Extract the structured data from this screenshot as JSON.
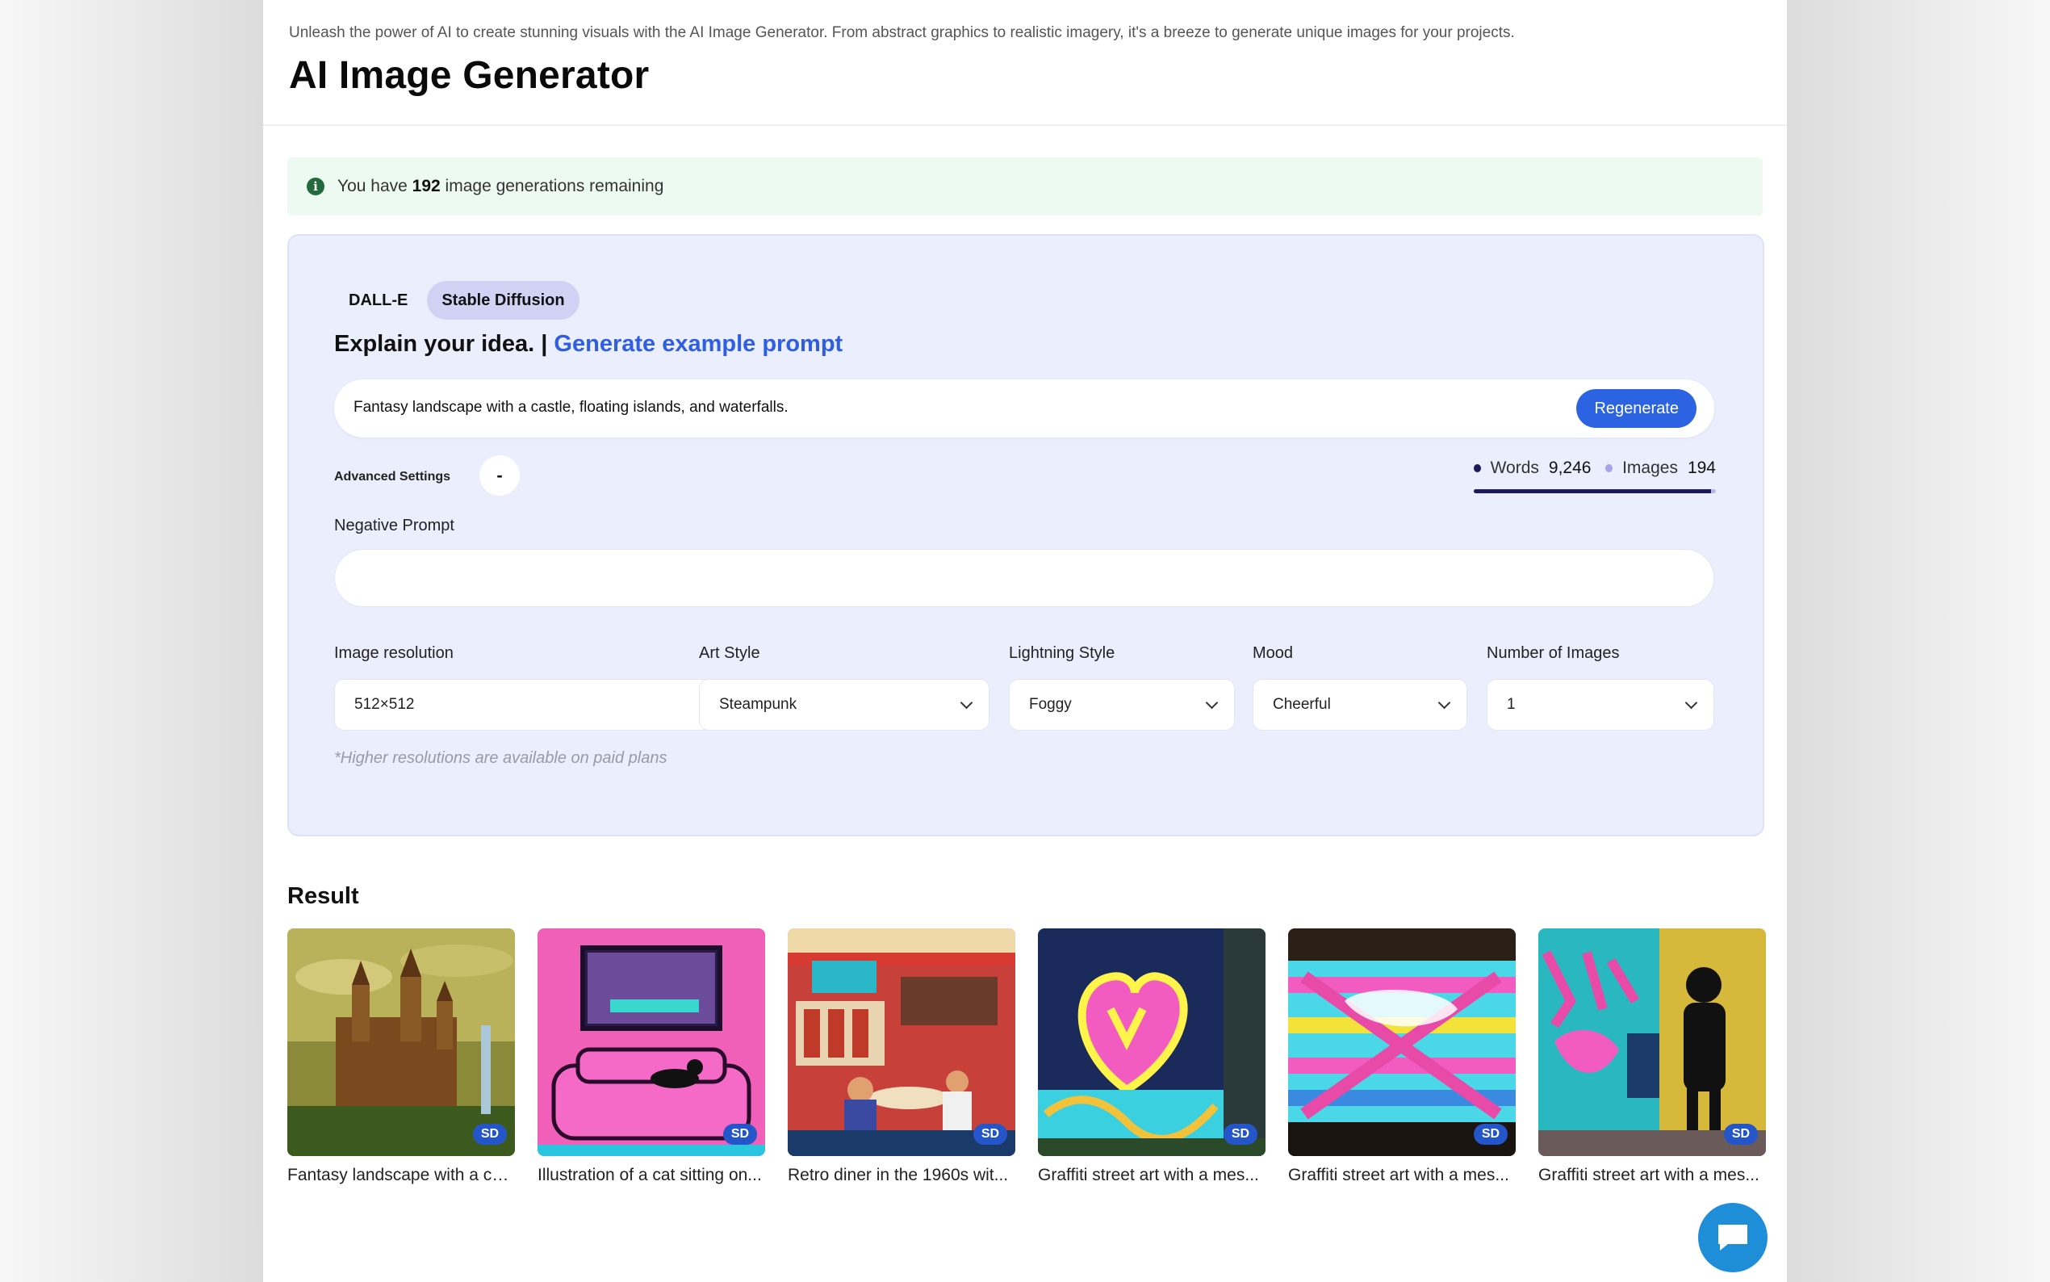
{
  "header": {
    "subtitle": "Unleash the power of AI to create stunning visuals with the AI Image Generator. From abstract graphics to realistic imagery, it's a breeze to generate unique images for your projects.",
    "title": "AI Image Generator"
  },
  "alert": {
    "prefix": "You have",
    "count": "192",
    "suffix": "image generations remaining",
    "icon": "info-icon",
    "color": "#236b3c"
  },
  "engines": [
    {
      "label": "DALL-E",
      "active": false
    },
    {
      "label": "Stable Diffusion",
      "active": true
    }
  ],
  "idea": {
    "heading": "Explain your idea. |",
    "link": "Generate example prompt"
  },
  "prompt": {
    "value": "Fantasy landscape with a castle, floating islands, and waterfalls.",
    "button": "Regenerate"
  },
  "advanced": {
    "label": "Advanced Settings",
    "toggle": "-"
  },
  "credits": {
    "words_label": "Words",
    "words_value": "9,246",
    "images_label": "Images",
    "images_value": "194",
    "words_fraction": 0.98
  },
  "negative_prompt": {
    "label": "Negative Prompt",
    "value": ""
  },
  "settings": {
    "resolution": {
      "label": "Image resolution",
      "value": "512×512"
    },
    "art_style": {
      "label": "Art Style",
      "value": "Steampunk"
    },
    "lighting": {
      "label": "Lightning Style",
      "value": "Foggy"
    },
    "mood": {
      "label": "Mood",
      "value": "Cheerful"
    },
    "count": {
      "label": "Number of Images",
      "value": "1"
    }
  },
  "note": "*Higher resolutions are available on paid plans",
  "result": {
    "title": "Result",
    "badge": "SD",
    "items": [
      {
        "caption": "Fantasy landscape with a ca..."
      },
      {
        "caption": "Illustration of a cat sitting on..."
      },
      {
        "caption": "Retro diner in the 1960s wit..."
      },
      {
        "caption": "Graffiti street art with a mes..."
      },
      {
        "caption": "Graffiti street art with a mes..."
      },
      {
        "caption": "Graffiti street art with a mes..."
      }
    ]
  },
  "chat": {
    "icon": "chat-icon",
    "color": "#1e8ed8"
  },
  "colors": {
    "accent": "#2b63e3",
    "panel": "#ebeefc",
    "alert_bg": "#ecfaf1"
  }
}
